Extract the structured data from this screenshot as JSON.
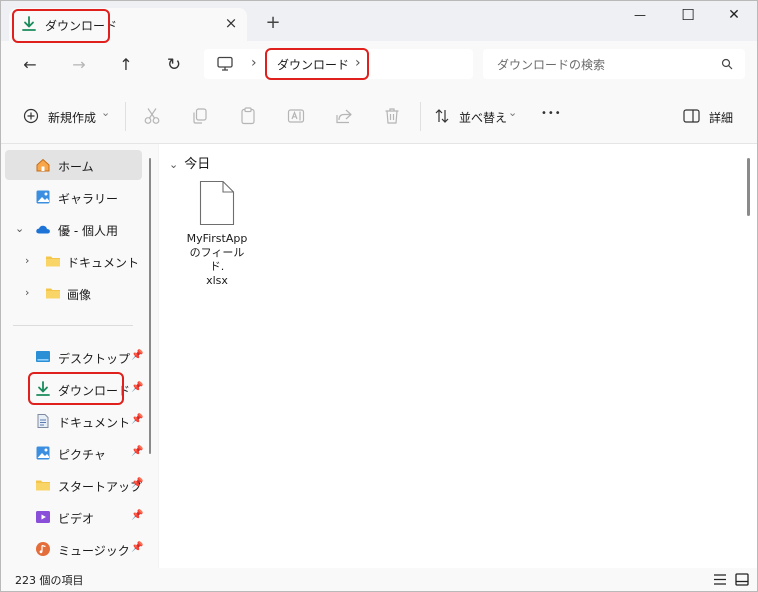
{
  "tab": {
    "title": "ダウンロード",
    "close_glyph": "×",
    "new_glyph": "+"
  },
  "window": {
    "minimize_glyph": "—",
    "maximize_glyph": "☐",
    "close_glyph": "✕"
  },
  "nav": {
    "back_glyph": "←",
    "forward_glyph": "→",
    "up_glyph": "↑",
    "refresh_glyph": "↻",
    "breadcrumb": "ダウンロード",
    "separator_glyph": "›"
  },
  "search": {
    "placeholder": "ダウンロードの検索"
  },
  "commands": {
    "new_label": "新規作成",
    "sort_label": "並べ替え",
    "more_glyph": "•••",
    "details_label": "詳細",
    "dropdown_glyph": "⌄"
  },
  "sidebar": {
    "items": [
      {
        "label": "ホーム",
        "icon": "home-icon"
      },
      {
        "label": "ギャラリー",
        "icon": "gallery-icon"
      },
      {
        "label": "優 - 個人用",
        "icon": "onedrive-icon"
      },
      {
        "label": "ドキュメント",
        "icon": "folder-icon"
      },
      {
        "label": "画像",
        "icon": "folder-icon"
      }
    ],
    "quick_access": [
      {
        "label": "デスクトップ",
        "icon": "desktop-icon"
      },
      {
        "label": "ダウンロード",
        "icon": "download-icon"
      },
      {
        "label": "ドキュメント",
        "icon": "document-icon"
      },
      {
        "label": "ピクチャ",
        "icon": "pictures-icon"
      },
      {
        "label": "スタートアップ",
        "icon": "folder-icon"
      },
      {
        "label": "ビデオ",
        "icon": "video-icon"
      },
      {
        "label": "ミュージック",
        "icon": "music-icon"
      }
    ],
    "pin_glyph": "📌",
    "expand_glyph": "›",
    "collapse_glyph": "⌄"
  },
  "content": {
    "group_header": "今日",
    "group_chevron": "⌄",
    "files": [
      {
        "line1": "MyFirstApp",
        "line2": "のフィールド.",
        "line3": "xlsx",
        "icon": "file-icon"
      }
    ]
  },
  "status": {
    "item_count": "223 個の項目"
  },
  "colors": {
    "highlight": "#e0201c",
    "accent_download": "#1a8a5a",
    "folder": "#f3c64b"
  }
}
